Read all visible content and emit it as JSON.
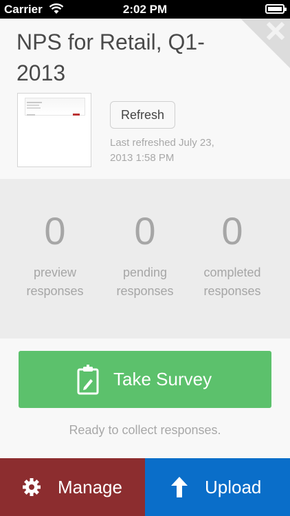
{
  "status_bar": {
    "carrier": "Carrier",
    "time": "2:02 PM",
    "wifi_icon": "wifi-icon",
    "battery_icon": "battery-icon"
  },
  "survey": {
    "title": "NPS for Retail, Q1-2013",
    "refresh_label": "Refresh",
    "last_refreshed": "Last refreshed July 23, 2013 1:58 PM"
  },
  "stats": [
    {
      "count": "0",
      "label": "preview responses"
    },
    {
      "count": "0",
      "label": "pending responses"
    },
    {
      "count": "0",
      "label": "completed responses"
    }
  ],
  "actions": {
    "take_survey_label": "Take Survey",
    "take_survey_icon": "clipboard-pencil-icon",
    "ready_text": "Ready to collect responses.",
    "manage_label": "Manage",
    "manage_icon": "gear-icon",
    "upload_label": "Upload",
    "upload_icon": "arrow-up-icon",
    "close_icon": "close-icon"
  },
  "colors": {
    "take_survey": "#5cc16c",
    "manage": "#8c2d2f",
    "upload": "#0a6ec9",
    "stats_background": "#ececec"
  }
}
